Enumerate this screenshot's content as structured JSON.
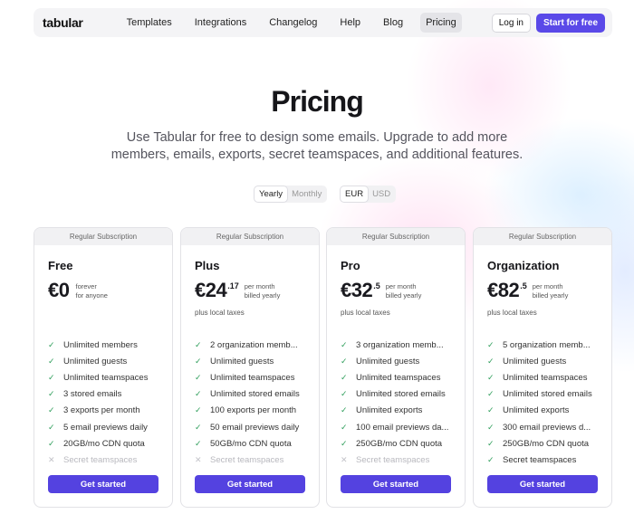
{
  "nav": {
    "logo": "tabular",
    "links": [
      "Templates",
      "Integrations",
      "Changelog",
      "Help",
      "Blog",
      "Pricing"
    ],
    "login": "Log in",
    "start": "Start for free"
  },
  "hero": {
    "title": "Pricing",
    "subtitle": "Use Tabular for free to design some emails. Upgrade to add more members, emails, exports, secret teamspaces, and additional features."
  },
  "billing_toggle": {
    "options": [
      "Yearly",
      "Monthly"
    ],
    "selected": "Yearly"
  },
  "currency_toggle": {
    "options": [
      "EUR",
      "USD"
    ],
    "selected": "EUR"
  },
  "plans": [
    {
      "header": "Regular Subscription",
      "name": "Free",
      "price": "€0",
      "cents": "",
      "note1": "forever",
      "note2": "for anyone",
      "tax": "",
      "features": [
        {
          "text": "Unlimited members",
          "included": true
        },
        {
          "text": "Unlimited guests",
          "included": true
        },
        {
          "text": "Unlimited teamspaces",
          "included": true
        },
        {
          "text": "3 stored emails",
          "included": true
        },
        {
          "text": "3 exports per month",
          "included": true
        },
        {
          "text": "5 email previews daily",
          "included": true
        },
        {
          "text": "20GB/mo CDN quota",
          "included": true
        },
        {
          "text": "Secret teamspaces",
          "included": false
        }
      ],
      "cta": "Get started"
    },
    {
      "header": "Regular Subscription",
      "name": "Plus",
      "price": "€24",
      "cents": ".17",
      "note1": "per month",
      "note2": "billed yearly",
      "tax": "plus local taxes",
      "features": [
        {
          "text": "2 organization memb...",
          "included": true
        },
        {
          "text": "Unlimited guests",
          "included": true
        },
        {
          "text": "Unlimited teamspaces",
          "included": true
        },
        {
          "text": "Unlimited stored emails",
          "included": true
        },
        {
          "text": "100 exports per month",
          "included": true
        },
        {
          "text": "50 email previews daily",
          "included": true
        },
        {
          "text": "50GB/mo CDN quota",
          "included": true
        },
        {
          "text": "Secret teamspaces",
          "included": false
        }
      ],
      "cta": "Get started"
    },
    {
      "header": "Regular Subscription",
      "name": "Pro",
      "price": "€32",
      "cents": ".5",
      "note1": "per month",
      "note2": "billed yearly",
      "tax": "plus local taxes",
      "features": [
        {
          "text": "3 organization memb...",
          "included": true
        },
        {
          "text": "Unlimited guests",
          "included": true
        },
        {
          "text": "Unlimited teamspaces",
          "included": true
        },
        {
          "text": "Unlimited stored emails",
          "included": true
        },
        {
          "text": "Unlimited exports",
          "included": true
        },
        {
          "text": "100 email previews da...",
          "included": true
        },
        {
          "text": "250GB/mo CDN quota",
          "included": true
        },
        {
          "text": "Secret teamspaces",
          "included": false
        }
      ],
      "cta": "Get started"
    },
    {
      "header": "Regular Subscription",
      "name": "Organization",
      "price": "€82",
      "cents": ".5",
      "note1": "per month",
      "note2": "billed yearly",
      "tax": "plus local taxes",
      "features": [
        {
          "text": "5 organization memb...",
          "included": true
        },
        {
          "text": "Unlimited guests",
          "included": true
        },
        {
          "text": "Unlimited teamspaces",
          "included": true
        },
        {
          "text": "Unlimited stored emails",
          "included": true
        },
        {
          "text": "Unlimited exports",
          "included": true
        },
        {
          "text": "300 email previews d...",
          "included": true
        },
        {
          "text": "250GB/mo CDN quota",
          "included": true
        },
        {
          "text": "Secret teamspaces",
          "included": true
        }
      ],
      "cta": "Get started"
    }
  ],
  "icons": {
    "check": "check-icon",
    "cross": "cross-icon"
  },
  "colors": {
    "accent": "#5442e0",
    "check": "#2f9e5b"
  }
}
